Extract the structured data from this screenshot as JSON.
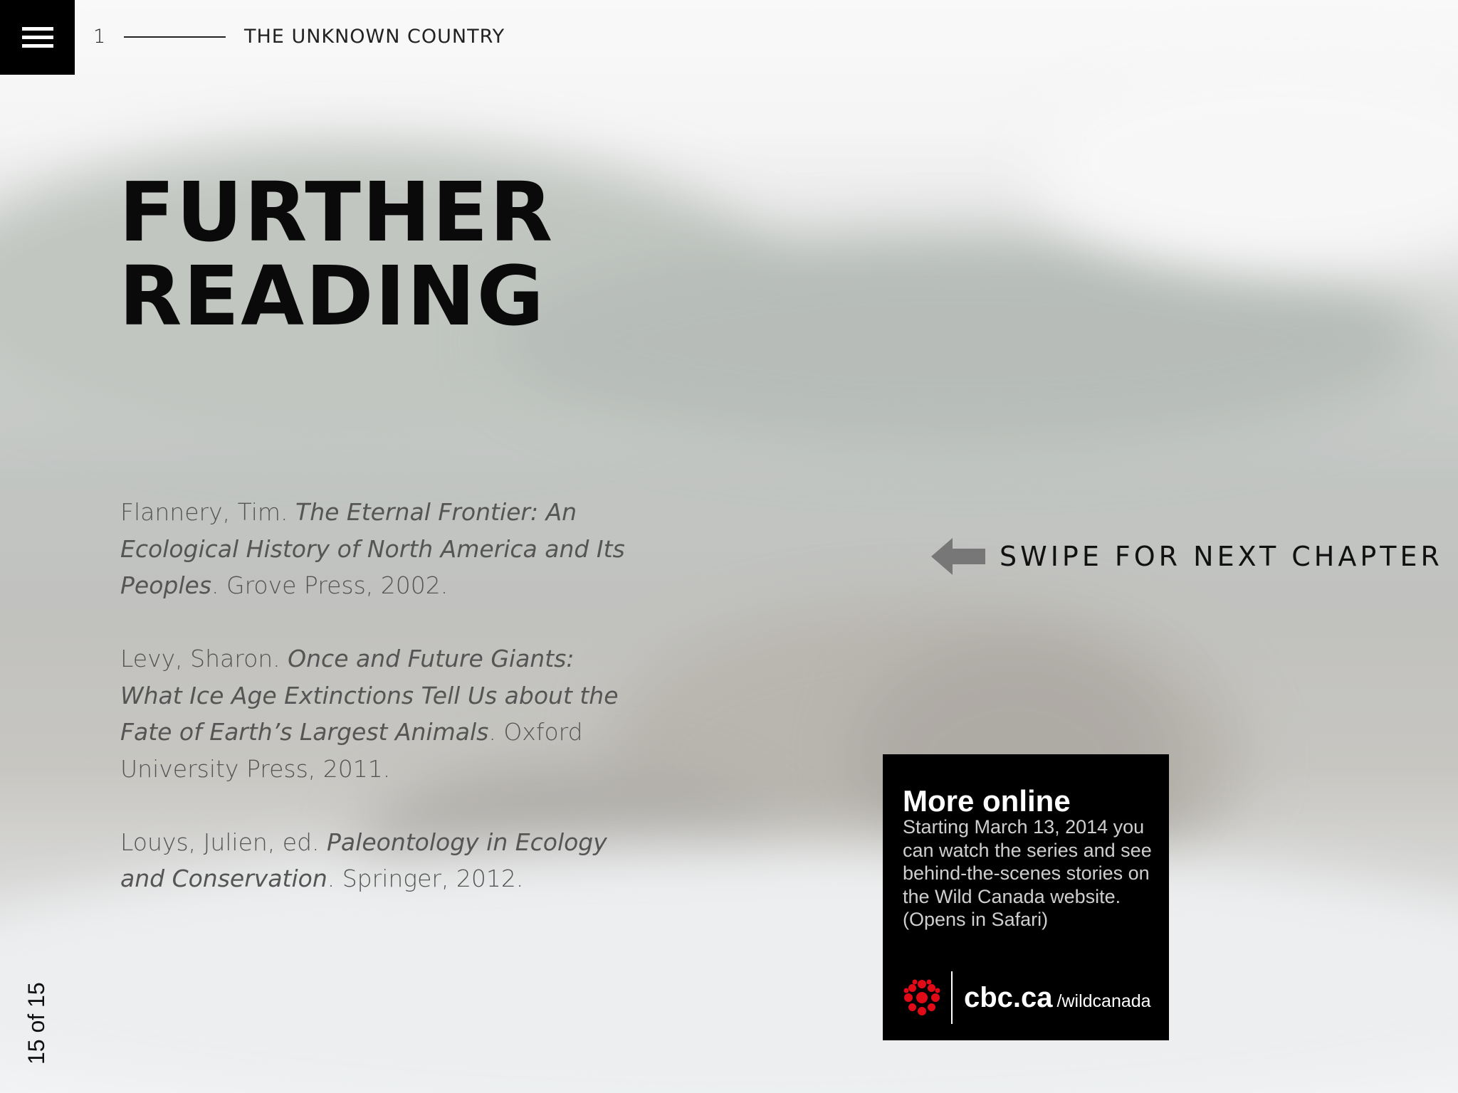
{
  "header": {
    "menu_icon": "hamburger-menu-icon",
    "chapter_number": "1",
    "book_title": "THE UNKNOWN COUNTRY"
  },
  "page": {
    "title_line1": "FURTHER",
    "title_line2": "READING"
  },
  "references": [
    {
      "author": "Flannery, Tim. ",
      "title": "The Eternal Frontier: An Ecological History of North America and Its Peoples",
      "publisher": ". Grove Press, 2002."
    },
    {
      "author": "Levy, Sharon. ",
      "title": "Once and Future Giants: What Ice Age Extinctions Tell Us about the Fate of Earth’s Largest Animals",
      "publisher": ". Oxford University Press, 2011."
    },
    {
      "author": "Louys, Julien, ed. ",
      "title": "Paleontology in Ecology and Conservation",
      "publisher": ". Springer, 2012."
    }
  ],
  "swipe": {
    "icon": "arrow-left-icon",
    "label": "SWIPE FOR NEXT CHAPTER"
  },
  "promo": {
    "title": "More online",
    "body": "Starting March 13, 2014 you can watch the series and see behind-the-scenes stories on the Wild Canada website. (Opens in Safari)",
    "logo_icon": "cbc-gem-icon",
    "site": "cbc.ca",
    "path": "/wildcanada"
  },
  "pager": {
    "label": "15 of 15"
  },
  "colors": {
    "accent_red": "#e10b17",
    "promo_bg": "#000000",
    "title_text": "#0a0a0a"
  }
}
